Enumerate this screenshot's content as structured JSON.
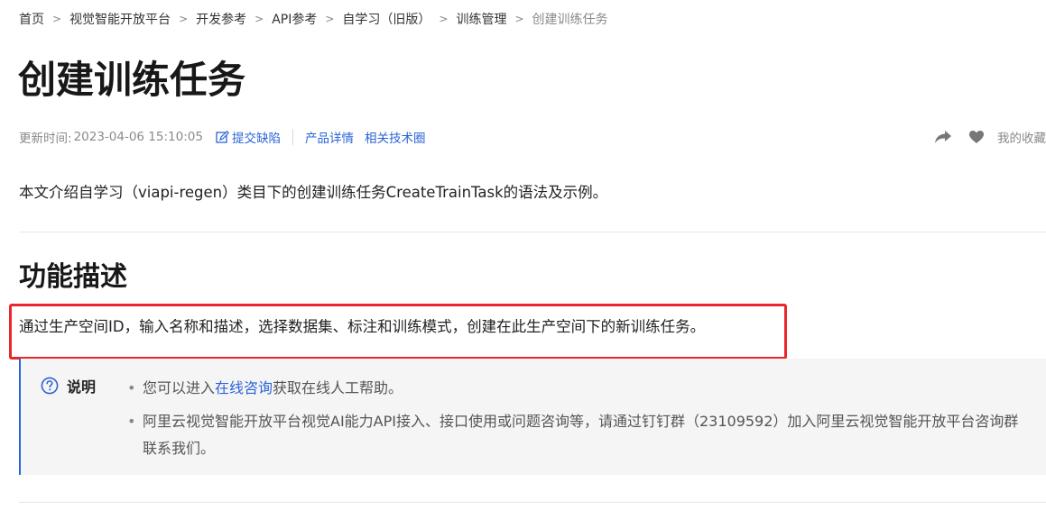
{
  "breadcrumb": {
    "items": [
      "首页",
      "视觉智能开放平台",
      "开发参考",
      "API参考",
      "自学习（旧版）",
      "训练管理"
    ],
    "current": "创建训练任务",
    "separator": ">"
  },
  "title": "创建训练任务",
  "meta": {
    "updated_label": "更新时间:",
    "updated_time": "2023-04-06 15:10:05",
    "feedback_label": "提交缺陷",
    "product_link": "产品详情",
    "community_link": "相关技术圈",
    "favorite_label": "我的收藏"
  },
  "intro": "本文介绍自学习（viapi-regen）类目下的创建训练任务CreateTrainTask的语法及示例。",
  "section": {
    "title": "功能描述",
    "description": "通过生产空间ID，输入名称和描述，选择数据集、标注和训练模式，创建在此生产空间下的新训练任务。"
  },
  "note": {
    "label": "说明",
    "item1_before": "您可以进入",
    "item1_link": "在线咨询",
    "item1_after": "获取在线人工帮助。",
    "item2": "阿里云视觉智能开放平台视觉AI能力API接入、接口使用或问题咨询等，请通过钉钉群（23109592）加入阿里云视觉智能开放平台咨询群联系我们。"
  },
  "colors": {
    "link": "#2a64d6",
    "highlight_border": "#e8262b",
    "note_background": "#f5f5f6",
    "note_accent": "#2a64d6"
  },
  "icons": [
    "edit-icon",
    "share-icon",
    "heart-icon",
    "question-circle-icon",
    "chevron-right-icon"
  ]
}
